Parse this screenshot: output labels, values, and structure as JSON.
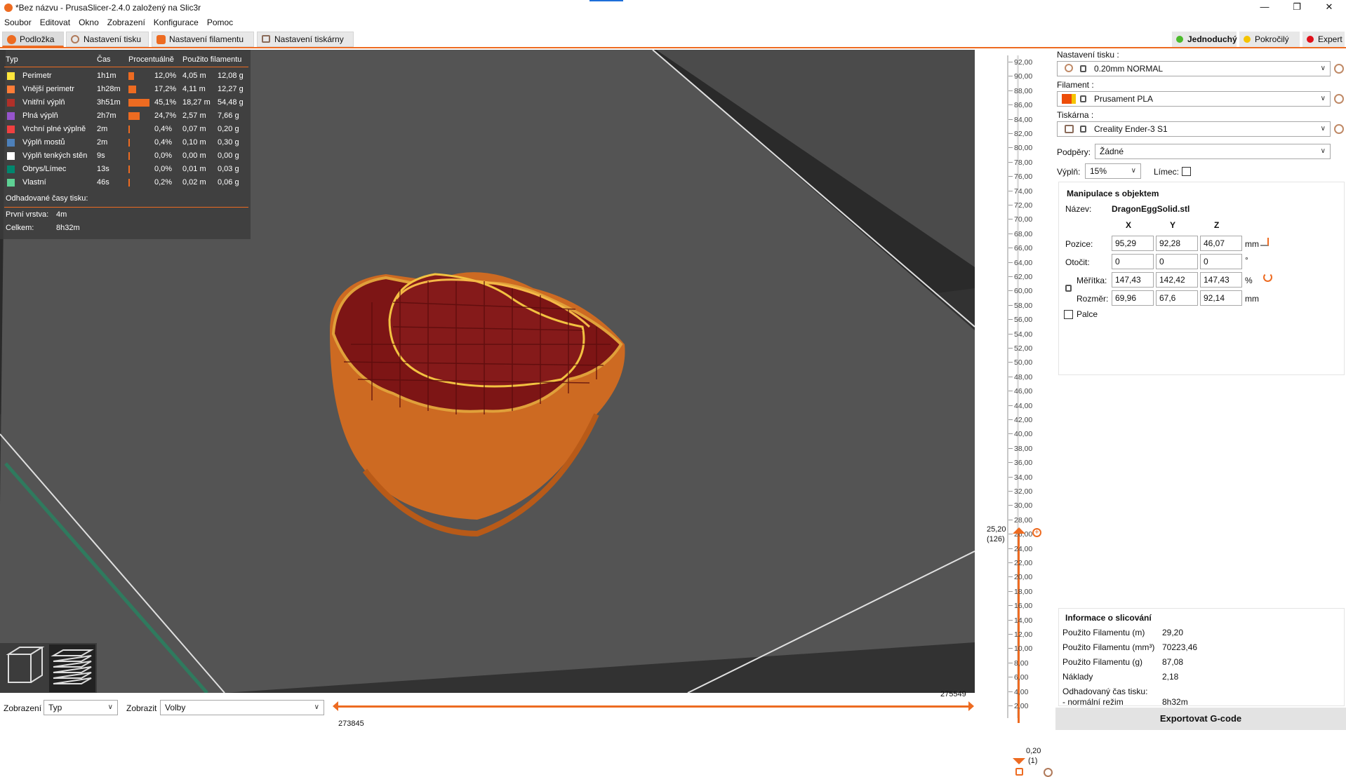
{
  "window": {
    "title": "*Bez názvu - PrusaSlicer-2.4.0 založený na Slic3r",
    "minimize": "—",
    "maximize": "❐",
    "close": "✕"
  },
  "menu": [
    "Soubor",
    "Editovat",
    "Okno",
    "Zobrazení",
    "Konfigurace",
    "Pomoc"
  ],
  "tabs": [
    "Podložka",
    "Nastavení tisku",
    "Nastavení filamentu",
    "Nastavení tiskárny"
  ],
  "modes": [
    {
      "label": "Jednoduchý",
      "color": "#4cbb2c"
    },
    {
      "label": "Pokročilý",
      "color": "#f5c400"
    },
    {
      "label": "Expert",
      "color": "#e0101a"
    }
  ],
  "legend": {
    "headers": [
      "Typ",
      "Čas",
      "Procentuálně",
      "Použito filamentu"
    ],
    "rows": [
      {
        "name": "Perimetr",
        "time": "1h1m",
        "pct": "12,0%",
        "len": "4,05 m",
        "w": "12,08 g",
        "frac": 0.12,
        "color": "#ffe63c"
      },
      {
        "name": "Vnější perimetr",
        "time": "1h28m",
        "pct": "17,2%",
        "len": "4,11 m",
        "w": "12,27 g",
        "frac": 0.172,
        "color": "#ff7d38"
      },
      {
        "name": "Vnitřní výplň",
        "time": "3h51m",
        "pct": "45,1%",
        "len": "18,27 m",
        "w": "54,48 g",
        "frac": 0.451,
        "color": "#b03029"
      },
      {
        "name": "Plná výplň",
        "time": "2h7m",
        "pct": "24,7%",
        "len": "2,57 m",
        "w": "7,66 g",
        "frac": 0.247,
        "color": "#9654cc"
      },
      {
        "name": "Vrchní plné výplně",
        "time": "2m",
        "pct": "0,4%",
        "len": "0,07 m",
        "w": "0,20 g",
        "frac": 0.004,
        "color": "#f04040"
      },
      {
        "name": "Výplň mostů",
        "time": "2m",
        "pct": "0,4%",
        "len": "0,10 m",
        "w": "0,30 g",
        "frac": 0.004,
        "color": "#4d80ba"
      },
      {
        "name": "Výplň tenkých stěn",
        "time": "9s",
        "pct": "0,0%",
        "len": "0,00 m",
        "w": "0,00 g",
        "frac": 0.0,
        "color": "#ffffff"
      },
      {
        "name": "Obrys/Límec",
        "time": "13s",
        "pct": "0,0%",
        "len": "0,01 m",
        "w": "0,03 g",
        "frac": 0.0,
        "color": "#00876e"
      },
      {
        "name": "Vlastní",
        "time": "46s",
        "pct": "0,2%",
        "len": "0,02 m",
        "w": "0,06 g",
        "frac": 0.002,
        "color": "#5ed194"
      }
    ],
    "est_title": "Odhadované časy tisku:",
    "first_layer_label": "První vrstva:",
    "first_layer_value": "4m",
    "total_label": "Celkem:",
    "total_value": "8h32m"
  },
  "slider": {
    "ticks": [
      "92,00",
      "90,00",
      "88,00",
      "86,00",
      "84,00",
      "82,00",
      "80,00",
      "78,00",
      "76,00",
      "74,00",
      "72,00",
      "70,00",
      "68,00",
      "66,00",
      "64,00",
      "62,00",
      "60,00",
      "58,00",
      "56,00",
      "54,00",
      "52,00",
      "50,00",
      "48,00",
      "46,00",
      "44,00",
      "42,00",
      "40,00",
      "38,00",
      "36,00",
      "34,00",
      "32,00",
      "30,00",
      "28,00",
      "26,00",
      "24,00",
      "22,00",
      "20,00",
      "18,00",
      "16,00",
      "14,00",
      "12,00",
      "10,00",
      "8,00",
      "6,00",
      "4,00",
      "2,00"
    ],
    "top_value": "25,20",
    "top_layer": "(126)",
    "bottom_value": "0,20",
    "bottom_layer": "(1)"
  },
  "sidebar": {
    "print_label": "Nastavení tisku :",
    "print_value": "0.20mm NORMAL",
    "filament_label": "Filament :",
    "filament_value": "Prusament PLA",
    "printer_label": "Tiskárna :",
    "printer_value": "Creality Ender-3 S1",
    "supports_label": "Podpěry:",
    "supports_value": "Žádné",
    "infill_label": "Výplň:",
    "infill_value": "15%",
    "brim_label": "Límec:",
    "manip_title": "Manipulace s objektem",
    "name_label": "Název:",
    "name_value": "DragonEggSolid.stl",
    "axes": [
      "X",
      "Y",
      "Z"
    ],
    "position_label": "Pozice:",
    "position": [
      "95,29",
      "92,28",
      "46,07"
    ],
    "position_unit": "mm",
    "rotation_label": "Otočit:",
    "rotation": [
      "0",
      "0",
      "0"
    ],
    "rotation_unit": "°",
    "scale_label": "Měřítka:",
    "scale": [
      "147,43",
      "142,42",
      "147,43"
    ],
    "scale_unit": "%",
    "size_label": "Rozměr:",
    "size": [
      "69,96",
      "67,6",
      "92,14"
    ],
    "size_unit": "mm",
    "inches_label": "Palce",
    "info_title": "Informace o slicování",
    "info": [
      {
        "label": "Použito Filamentu (m)",
        "value": "29,20"
      },
      {
        "label": "Použito Filamentu (mm³)",
        "value": "70223,46"
      },
      {
        "label": "Použito Filamentu (g)",
        "value": "87,08"
      },
      {
        "label": "Náklady",
        "value": "2,18"
      },
      {
        "label": "Odhadovaný čas tisku:",
        "value": ""
      },
      {
        "label": " - normální režim",
        "value": "8h32m"
      }
    ],
    "export_label": "Exportovat G-code"
  },
  "bottom": {
    "view_label": "Zobrazení",
    "view_value": "Typ",
    "show_label": "Zobrazit",
    "show_value": "Volby",
    "h_right_value": "275549",
    "h_left_value": "273845"
  }
}
